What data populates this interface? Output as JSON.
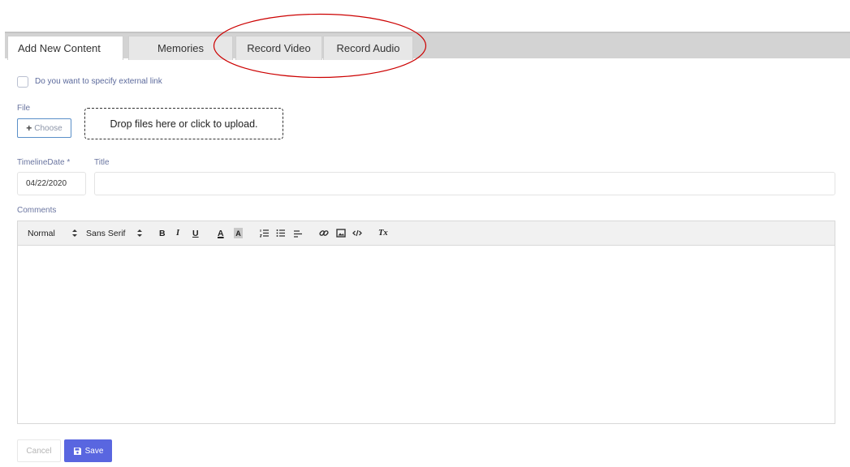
{
  "tabs": {
    "add_new_content": "Add New Content",
    "memories": "Memories",
    "record_video": "Record Video",
    "record_audio": "Record Audio"
  },
  "form": {
    "external_link_label": "Do you want to specify external link",
    "file_label": "File",
    "choose_label": "Choose",
    "dropzone_text": "Drop files here or click to upload.",
    "timeline_date_label": "TimelineDate *",
    "timeline_date_value": "04/22/2020",
    "title_label": "Title",
    "title_value": "",
    "comments_label": "Comments"
  },
  "editor_toolbar": {
    "header_select": "Normal",
    "font_select": "Sans Serif",
    "bold": "B",
    "italic": "I",
    "underline": "U",
    "font_color": "A",
    "background_color": "A",
    "clean": "Tx"
  },
  "actions": {
    "cancel": "Cancel",
    "save": "Save"
  },
  "colors": {
    "primary": "#5966e0",
    "annotation": "#cc0000",
    "label": "#6a75a0"
  }
}
